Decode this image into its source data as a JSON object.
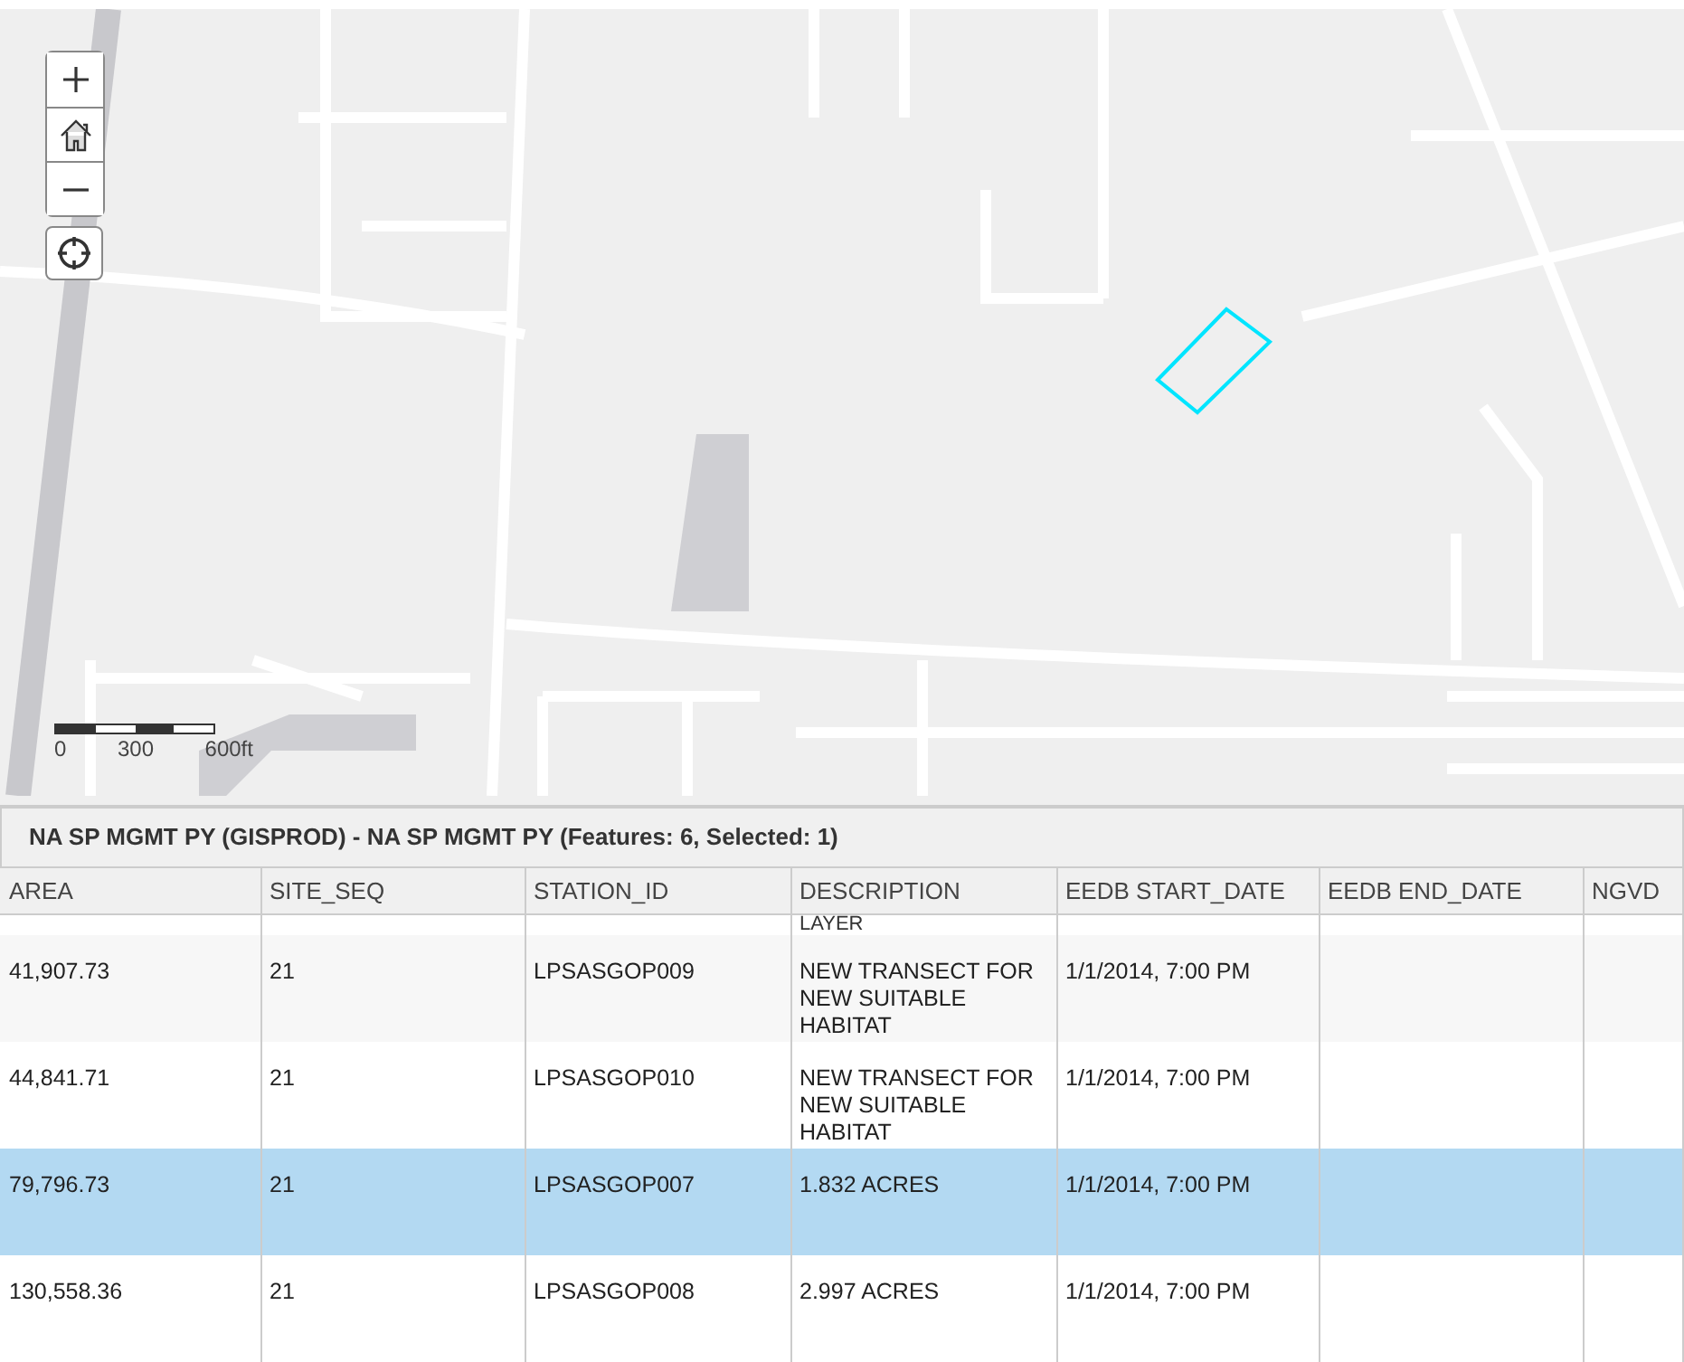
{
  "map": {
    "controls": [
      {
        "kind": "zoom_in"
      },
      {
        "kind": "home"
      },
      {
        "kind": "zoom_out"
      },
      {
        "kind": "locate"
      }
    ],
    "scale_bar": {
      "labels": [
        "0",
        "300",
        "600ft"
      ]
    }
  },
  "table": {
    "title": "NA SP MGMT PY (GISPROD) - NA SP MGMT PY (Features: 6, Selected: 1)",
    "columns": [
      "AREA",
      "SITE_SEQ",
      "STATION_ID",
      "DESCRIPTION",
      "EEDB START_DATE",
      "EEDB END_DATE",
      "NGVD"
    ],
    "partial_row": {
      "description": "LAYER"
    },
    "rows": [
      {
        "cells": [
          "41,907.73",
          "21",
          "LPSASGOP009",
          "NEW TRANSECT FOR NEW SUITABLE HABITAT",
          "1/1/2014, 7:00 PM",
          "",
          ""
        ],
        "selected": false
      },
      {
        "cells": [
          "44,841.71",
          "21",
          "LPSASGOP010",
          "NEW TRANSECT FOR NEW SUITABLE HABITAT",
          "1/1/2014, 7:00 PM",
          "",
          ""
        ],
        "selected": false
      },
      {
        "cells": [
          "79,796.73",
          "21",
          "LPSASGOP007",
          "1.832 ACRES",
          "1/1/2014, 7:00 PM",
          "",
          ""
        ],
        "selected": true
      },
      {
        "cells": [
          "130,558.36",
          "21",
          "LPSASGOP008",
          "2.997 ACRES",
          "1/1/2014, 7:00 PM",
          "",
          ""
        ],
        "selected": false
      }
    ]
  }
}
